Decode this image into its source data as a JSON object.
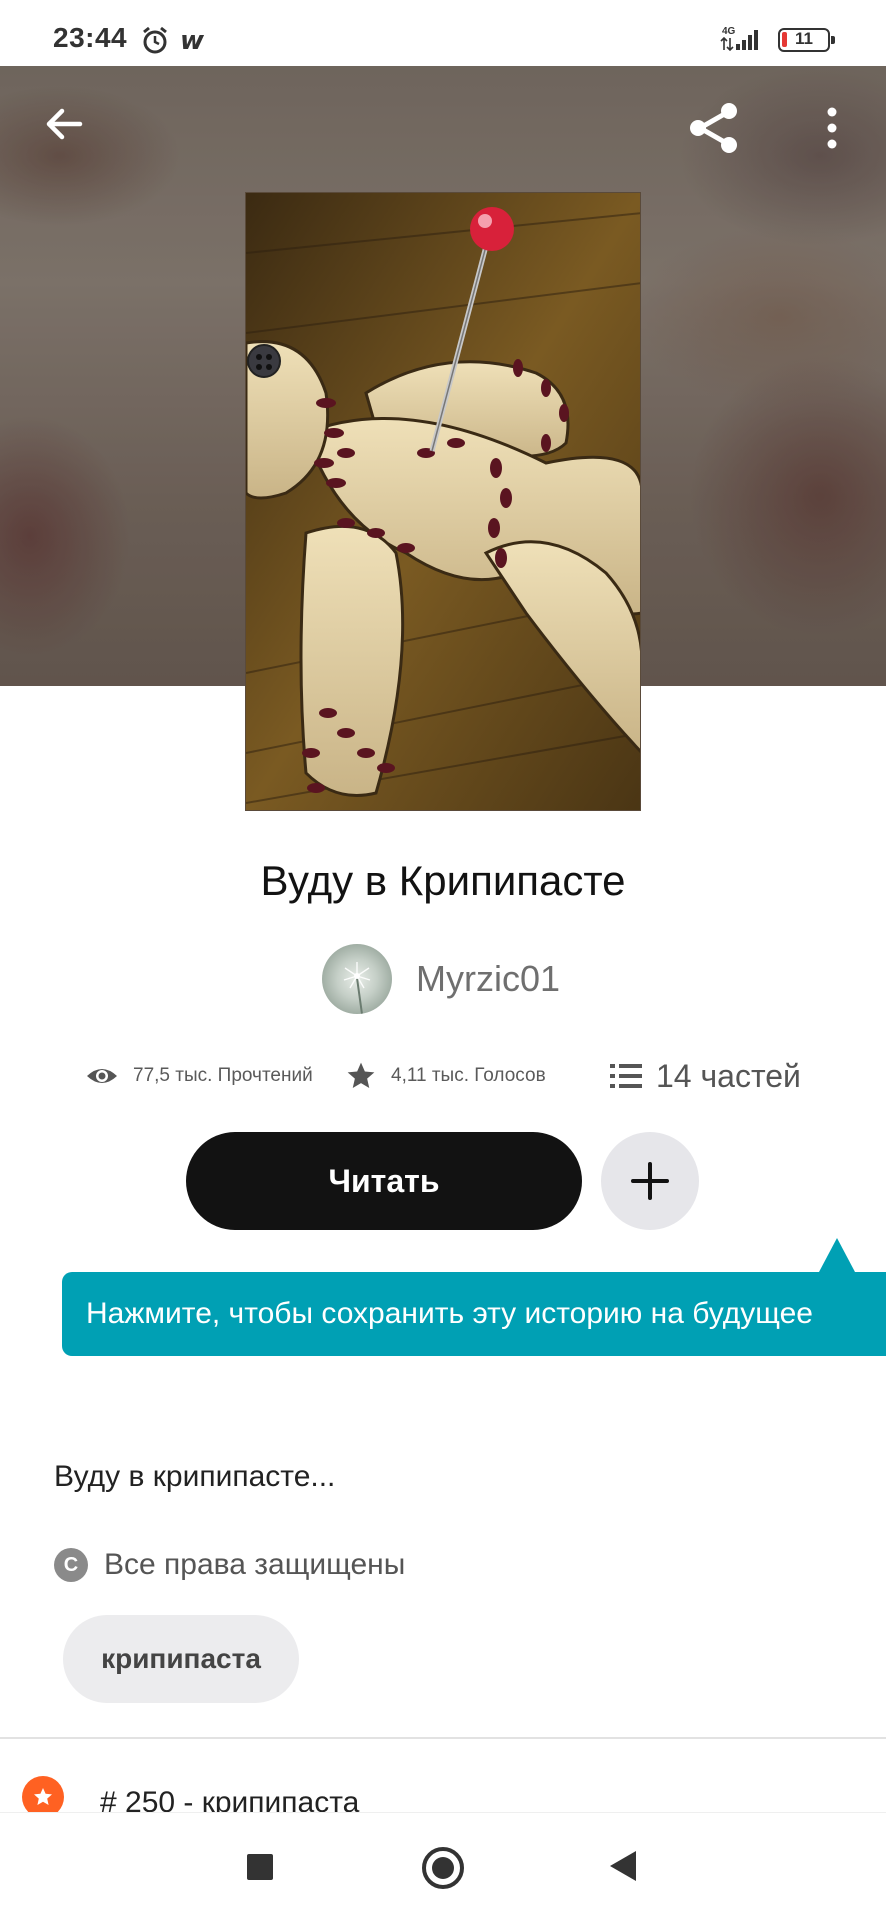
{
  "status_bar": {
    "time": "23:44",
    "network": "4G",
    "battery_level": "11",
    "icons": [
      "alarm-icon",
      "wattpad-icon",
      "signal-icon",
      "battery-icon"
    ]
  },
  "toolbar": {
    "back_icon": "arrow-left-icon",
    "share_icon": "share-icon",
    "more_icon": "more-vertical-icon"
  },
  "story": {
    "title": "Вуду в Крипипасте",
    "author": "Myrzic01",
    "reads": "77,5 тыс. Прочтений",
    "votes": "4,11 тыс. Голосов",
    "parts": "14 частей",
    "read_button": "Читать",
    "add_button_icon": "plus-icon",
    "description": "Вуду в крипипасте...",
    "copyright": "Все права защищены",
    "copyright_icon_glyph": "C",
    "tags": [
      "крипипаста"
    ],
    "rank": "# 250 - крипипаста"
  },
  "tooltip": {
    "text": "Нажмите, чтобы сохранить эту историю на будущее"
  },
  "colors": {
    "accent_teal": "#00a0b4",
    "read_button": "#121212",
    "rank_badge": "#ff6122"
  }
}
